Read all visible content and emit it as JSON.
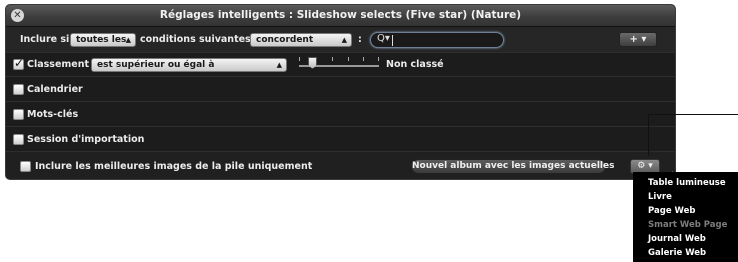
{
  "window": {
    "title": "Réglages intelligents : Slideshow selects (Five star) (Nature)",
    "close_glyph": "✕"
  },
  "filter_bar": {
    "include_label": "Inclure si",
    "match_select": "toutes les",
    "conditions_label": "conditions suivantes :",
    "mode_select": "concordent",
    "colon": ":",
    "search_icon": "Q▾",
    "search_value": "",
    "add_button": "+ ▾"
  },
  "rules": {
    "rating": {
      "checked": true,
      "label": "Classement :",
      "operator": "est supérieur ou égal à",
      "value_label": "Non classé"
    },
    "calendar": {
      "checked": false,
      "label": "Calendrier"
    },
    "keywords": {
      "checked": false,
      "label": "Mots-clés"
    },
    "import_session": {
      "checked": false,
      "label": "Session d'importation"
    }
  },
  "footer": {
    "stack_checkbox_checked": false,
    "stack_label": "Inclure les meilleures images de la pile uniquement",
    "new_album_button": "Nouvel album avec les images actuelles",
    "gear_button": "⚙ ▾"
  },
  "popup_menu": {
    "items": [
      {
        "label": "Table lumineuse",
        "enabled": true
      },
      {
        "label": "Livre",
        "enabled": true
      },
      {
        "label": "Page Web",
        "enabled": true
      },
      {
        "label": "Smart Web Page",
        "enabled": false
      },
      {
        "label": "Journal Web",
        "enabled": true
      },
      {
        "label": "Galerie Web",
        "enabled": true
      }
    ]
  },
  "colors": {
    "panel_bg": "#1c1c1c",
    "search_focus": "#8aa2c4",
    "menu_bg": "#000000",
    "menu_disabled": "#7d7d7d"
  }
}
